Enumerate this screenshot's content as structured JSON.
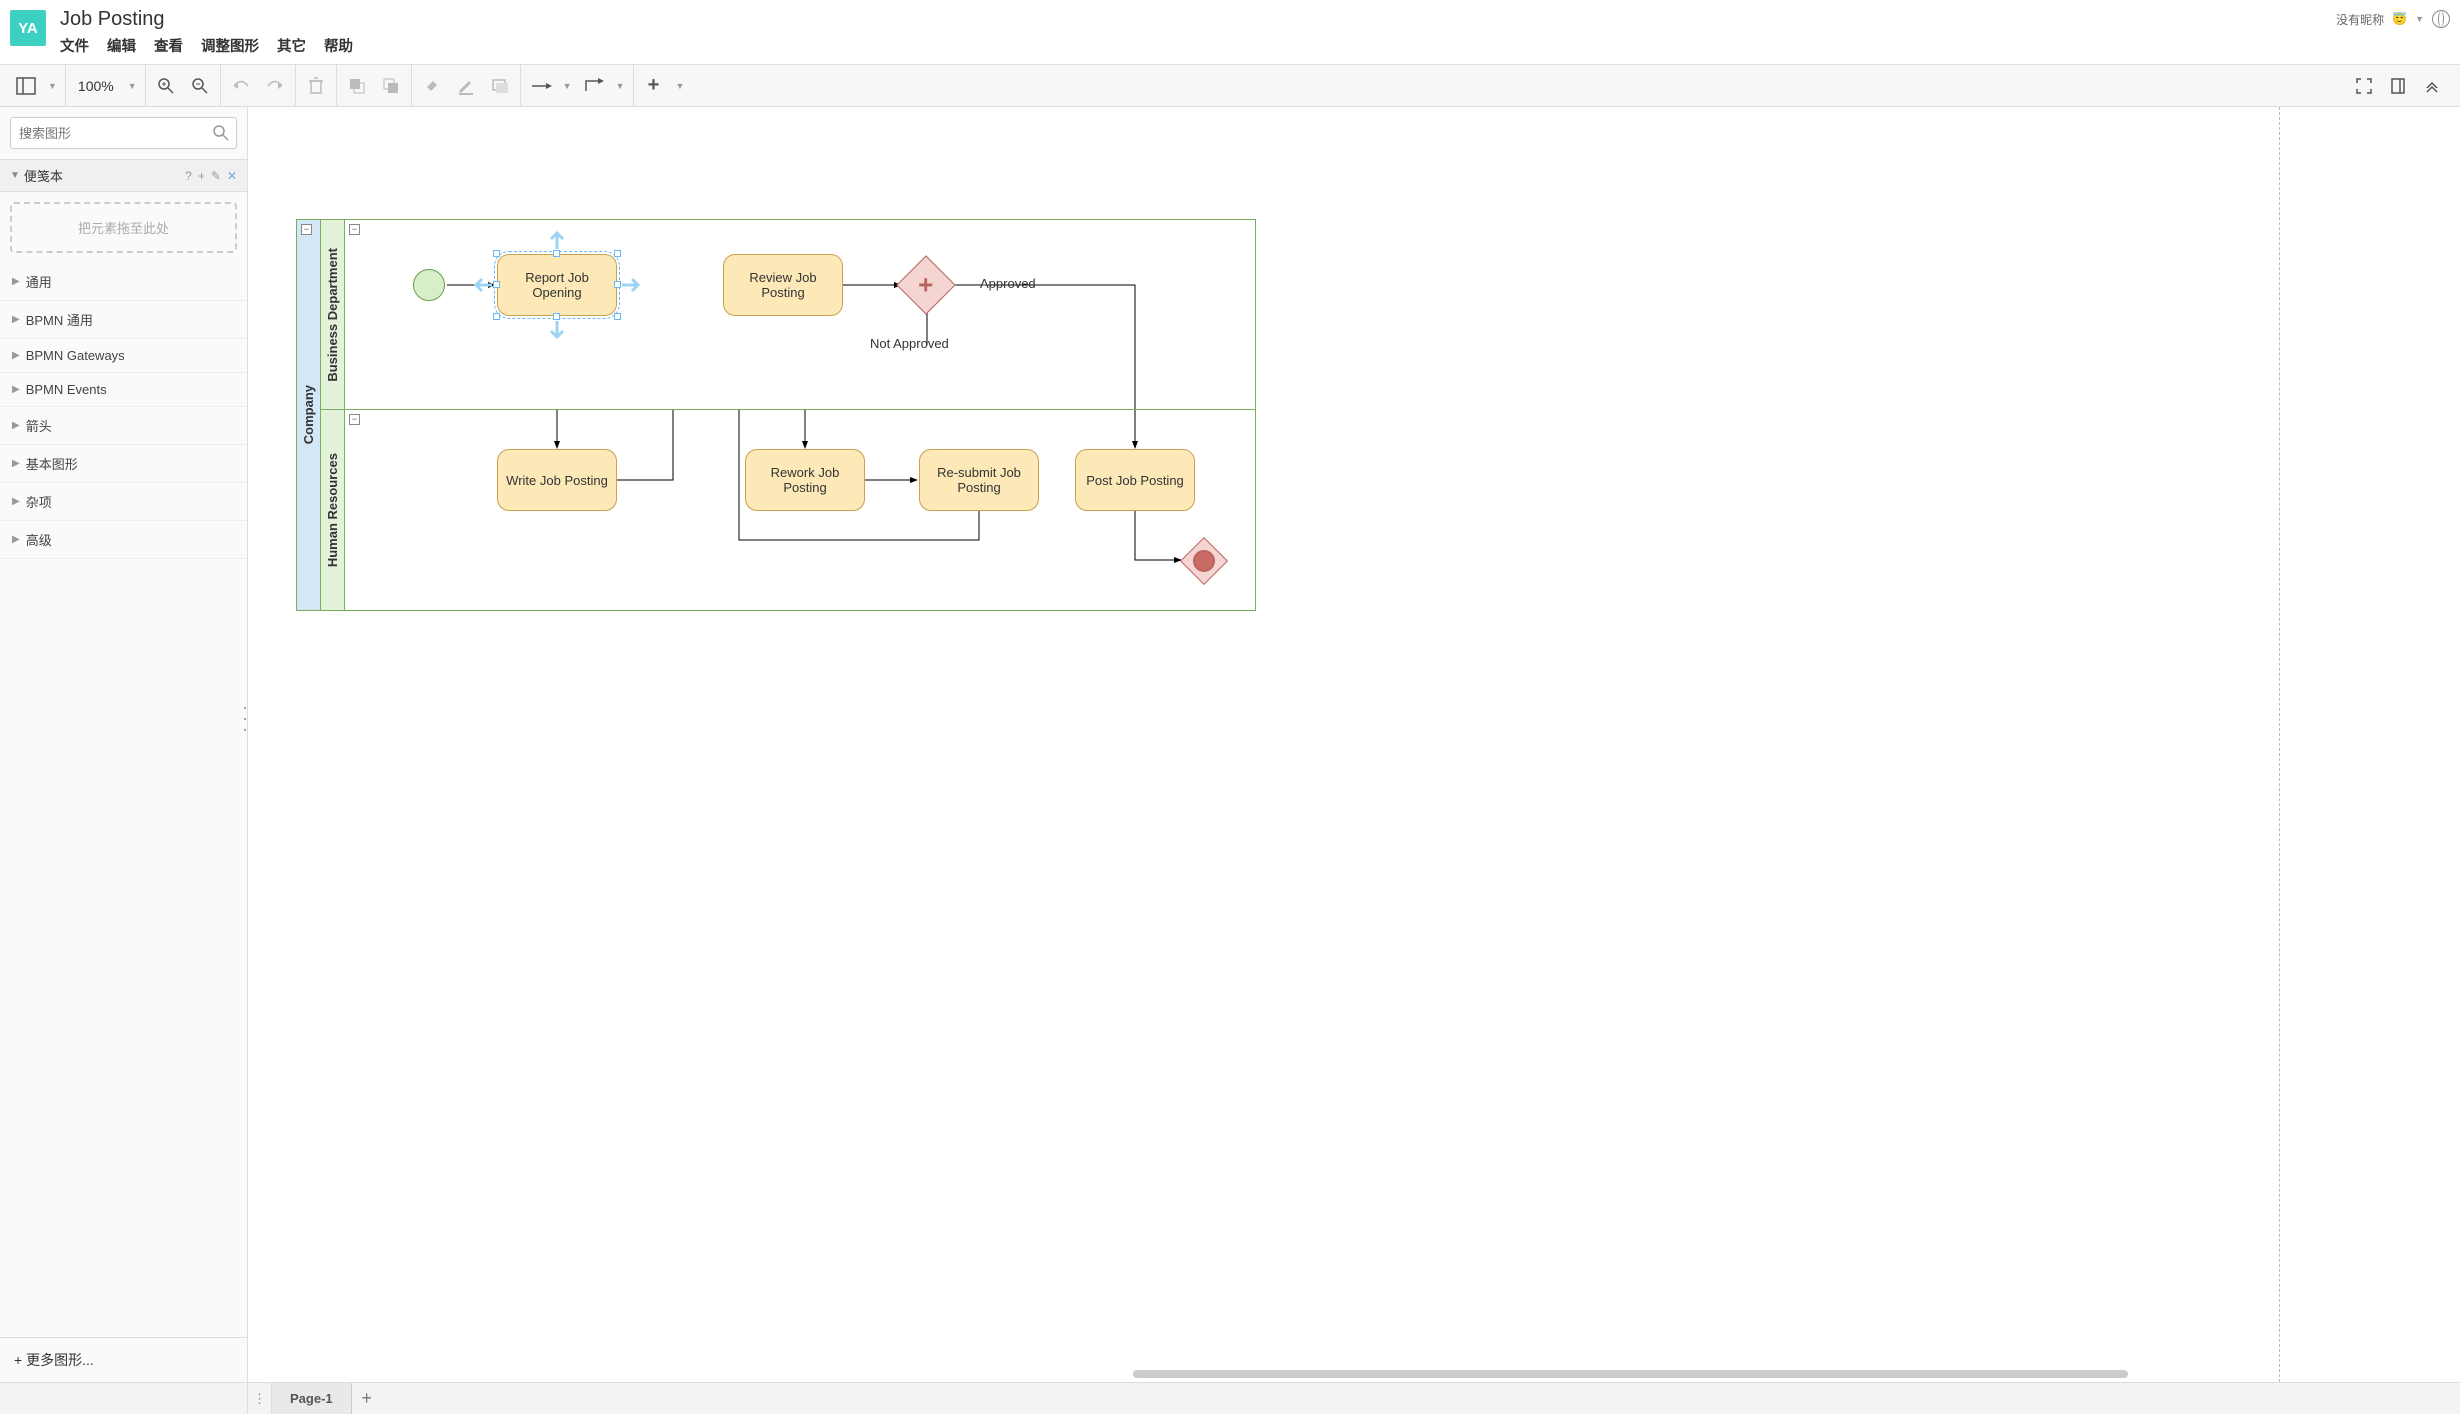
{
  "header": {
    "logo_text": "YA",
    "doc_title": "Job Posting",
    "menu": [
      "文件",
      "编辑",
      "查看",
      "调整图形",
      "其它",
      "帮助"
    ],
    "user_label": "没有昵称",
    "user_emoji": "😇"
  },
  "toolbar": {
    "zoom": "100%"
  },
  "sidebar": {
    "search_placeholder": "搜索图形",
    "scratchpad_title": "便笺本",
    "scratchpad_hint": "把元素拖至此处",
    "categories": [
      "通用",
      "BPMN 通用",
      "BPMN Gateways",
      "BPMN Events",
      "箭头",
      "基本图形",
      "杂项",
      "高级"
    ],
    "more_shapes": "+ 更多图形..."
  },
  "diagram": {
    "pool_label": "Company",
    "lanes": [
      "Business Department",
      "Human Resources"
    ],
    "tasks": {
      "report": "Report Job Opening",
      "review": "Review Job Posting",
      "write": "Write Job Posting",
      "rework": "Rework Job Posting",
      "resubmit": "Re-submit Job Posting",
      "post": "Post Job Posting"
    },
    "edge_labels": {
      "approved": "Approved",
      "not_approved": "Not Approved"
    }
  },
  "footer": {
    "page_tab": "Page-1"
  }
}
